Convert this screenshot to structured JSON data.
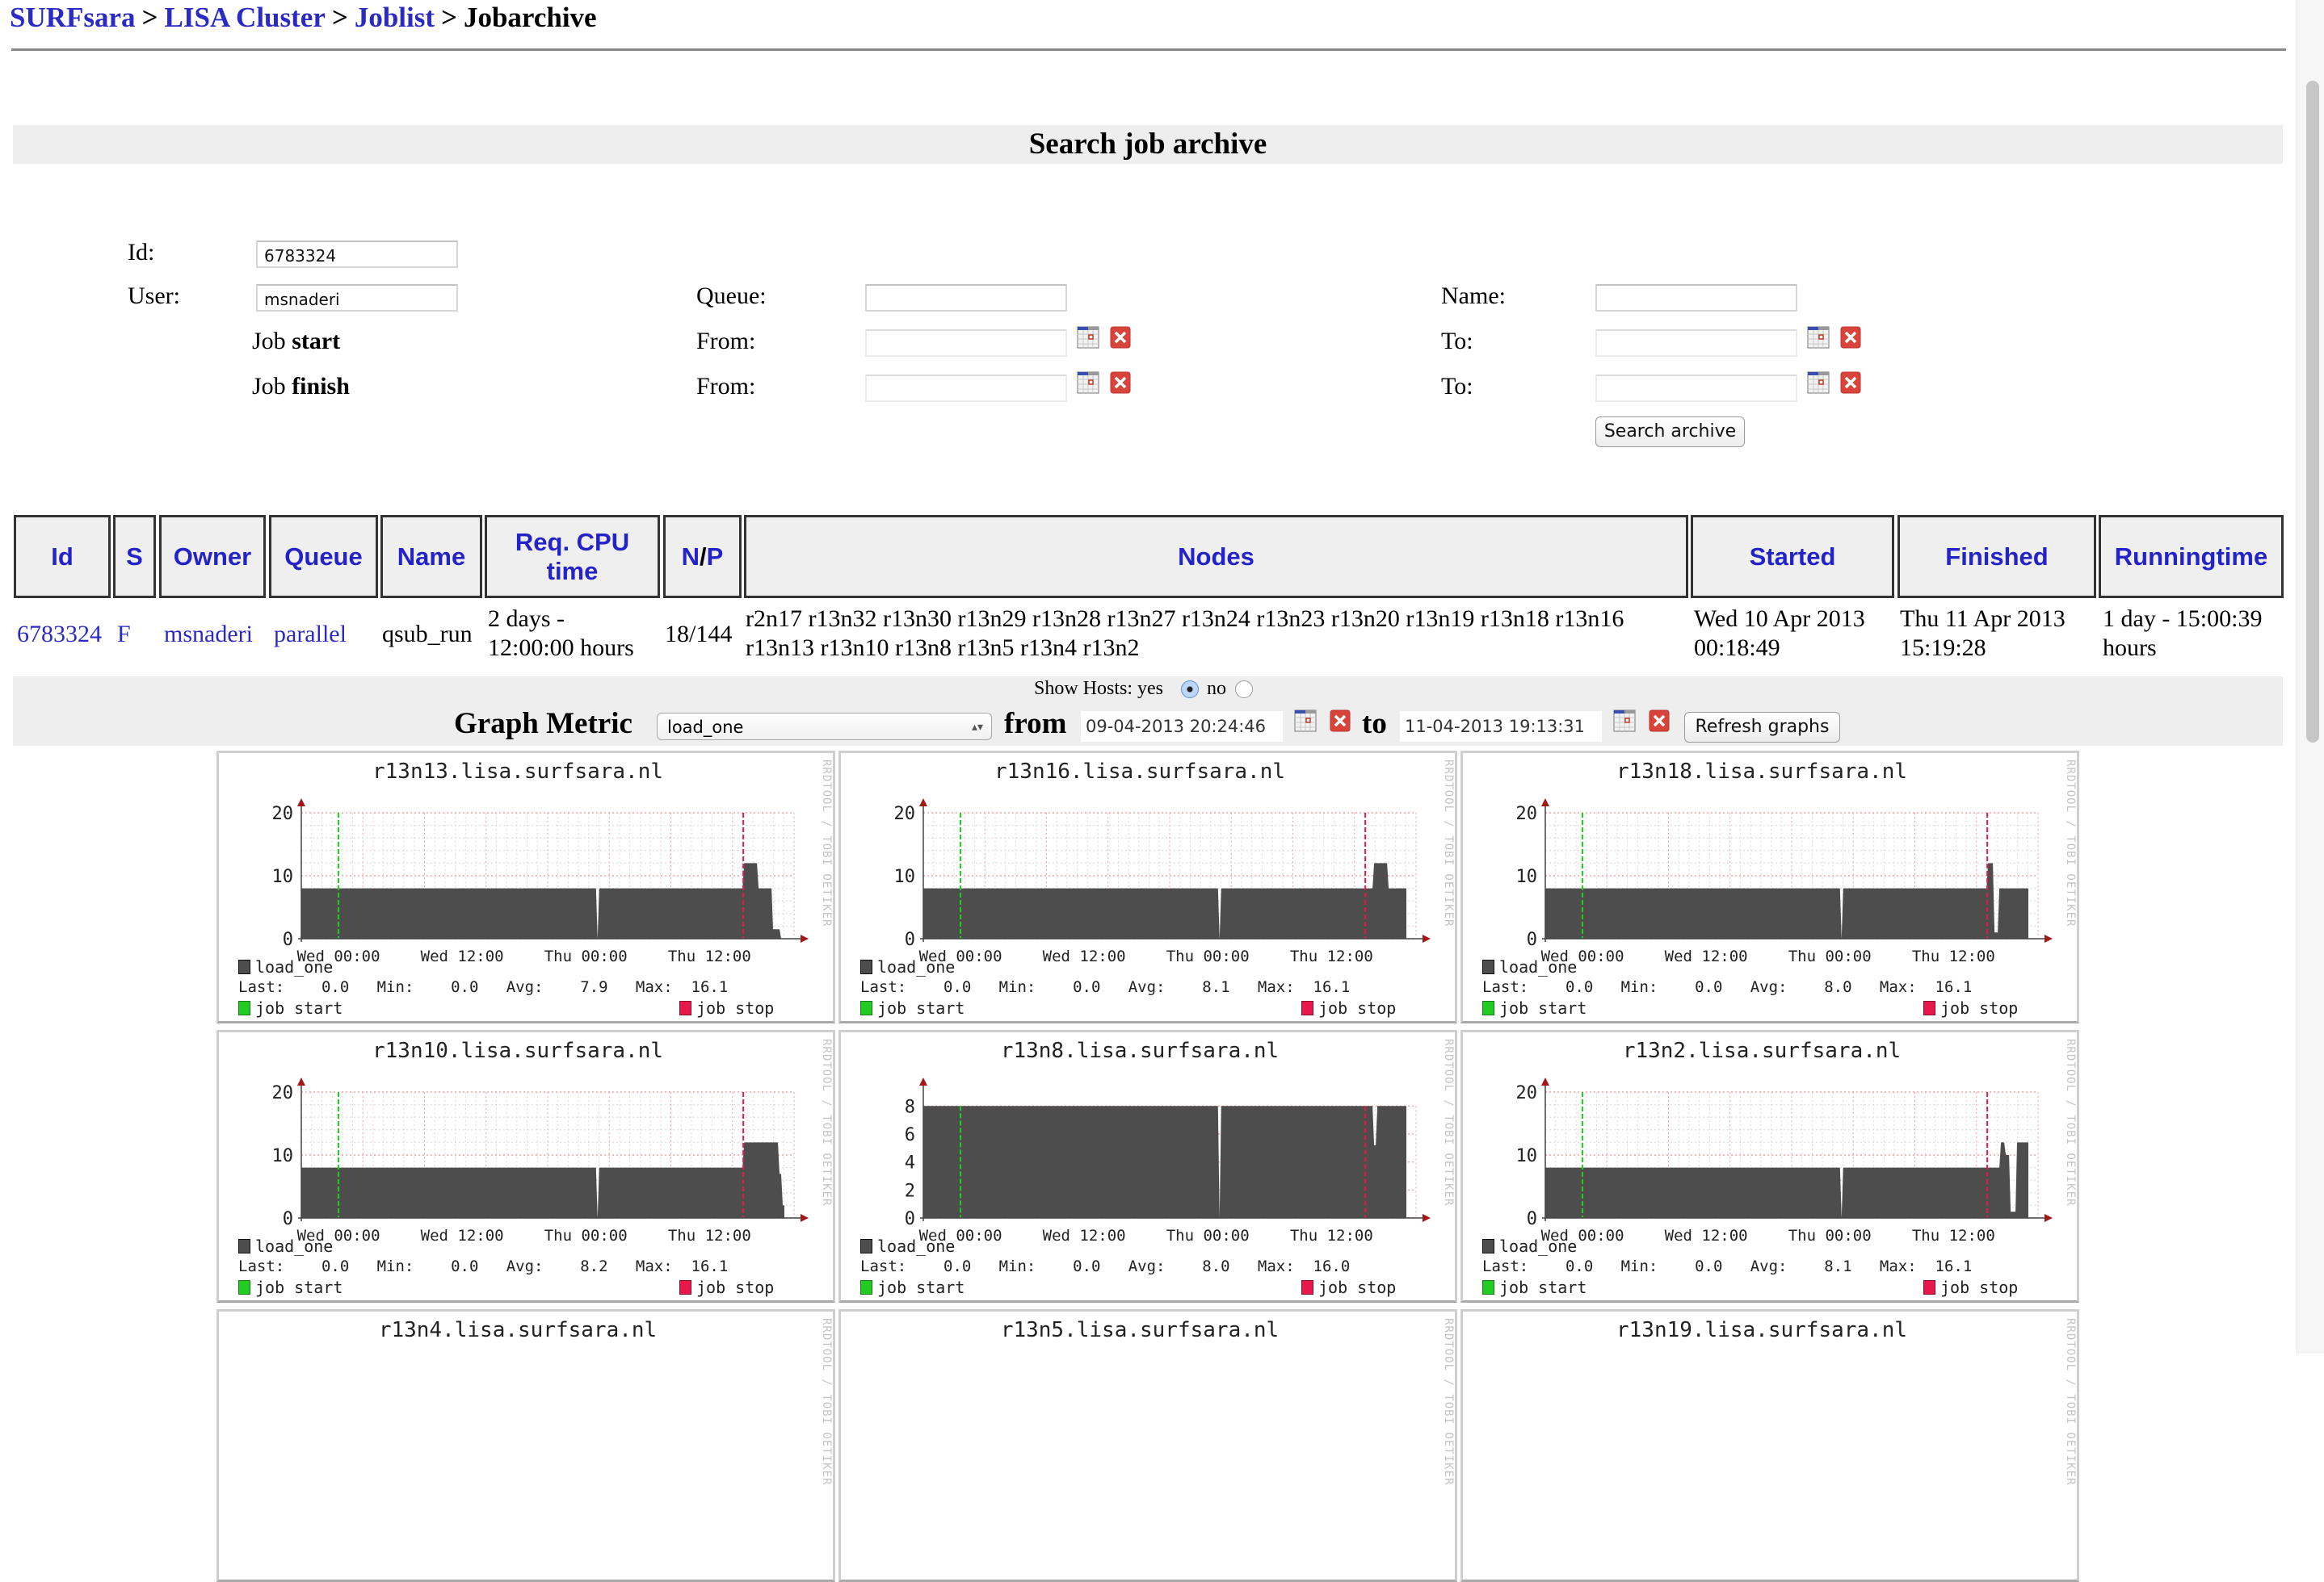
{
  "breadcrumb": {
    "items": [
      "SURFsara",
      "LISA Cluster",
      "Joblist",
      "Jobarchive"
    ],
    "separator": ">"
  },
  "search": {
    "title": "Search job archive",
    "id_label": "Id:",
    "id_value": "6783324",
    "user_label": "User:",
    "user_value": "msnaderi",
    "queue_label": "Queue:",
    "queue_value": "",
    "name_label": "Name:",
    "name_value": "",
    "job_start_prefix": "Job ",
    "job_start_bold": "start",
    "job_finish_prefix": "Job ",
    "job_finish_bold": "finish",
    "from_label": "From:",
    "to_label": "To:",
    "search_button": "Search archive"
  },
  "table": {
    "headers": [
      "Id",
      "S",
      "Owner",
      "Queue",
      "Name",
      "Req. CPU time",
      "N/P",
      "Nodes",
      "Started",
      "Finished",
      "Runningtime"
    ],
    "header_np": {
      "n": "N",
      "slash": "/",
      "p": "P"
    },
    "header_cpu": {
      "line1": "Req. CPU",
      "line2": "time"
    },
    "row": {
      "id": "6783324",
      "state": "F",
      "owner": "msnaderi",
      "queue": "parallel",
      "name": "qsub_run",
      "req_cpu_line1": "2 days -",
      "req_cpu_line2": "12:00:00 hours",
      "np": "18/144",
      "nodes_line1": "r2n17 r13n32 r13n30 r13n29 r13n28 r13n27 r13n24 r13n23 r13n20 r13n19 r13n18 r13n16",
      "nodes_line2": "r13n13 r13n10 r13n8 r13n5 r13n4 r13n2",
      "started_line1": "Wed 10 Apr 2013",
      "started_line2": "00:18:49",
      "finished_line1": "Thu 11 Apr 2013",
      "finished_line2": "15:19:28",
      "runningtime_line1": "1 day - 15:00:39",
      "runningtime_line2": "hours"
    }
  },
  "graph_controls": {
    "show_hosts_label": "Show Hosts: yes",
    "no_label": "no",
    "show_hosts": "yes",
    "metric_label": "Graph Metric",
    "metric_value": "load_one",
    "from_label": "from",
    "from_value": "09-04-2013 20:24:46",
    "to_label": "to",
    "to_value": "11-04-2013 19:13:31",
    "refresh_button": "Refresh graphs"
  },
  "graph_common": {
    "xticks": [
      "Wed 00:00",
      "Wed 12:00",
      "Thu 00:00",
      "Thu 12:00"
    ],
    "legend_series": "load_one",
    "legend_start": "job start",
    "legend_stop": "job stop",
    "watermark": "RRDTOOL / TOBI OETIKER",
    "last_label": "Last:",
    "min_label": "Min:",
    "avg_label": "Avg:",
    "max_label": "Max:",
    "colors": {
      "area": "#4d4d4d",
      "start": "#22cc22",
      "stop": "#e8194a"
    }
  },
  "chart_data": [
    {
      "type": "area",
      "title": "r13n13.lisa.surfsara.nl",
      "ylim": [
        0,
        20
      ],
      "yticks": [
        0,
        10,
        20
      ],
      "last": "0.0",
      "min": "0.0",
      "avg": "7.9",
      "max": "16.1",
      "tail": "drop"
    },
    {
      "type": "area",
      "title": "r13n16.lisa.surfsara.nl",
      "ylim": [
        0,
        20
      ],
      "yticks": [
        0,
        10,
        20
      ],
      "last": "0.0",
      "min": "0.0",
      "avg": "8.1",
      "max": "16.1",
      "tail": "bump"
    },
    {
      "type": "area",
      "title": "r13n18.lisa.surfsara.nl",
      "ylim": [
        0,
        20
      ],
      "yticks": [
        0,
        10,
        20
      ],
      "last": "0.0",
      "min": "0.0",
      "avg": "8.0",
      "max": "16.1",
      "tail": "dip"
    },
    {
      "type": "area",
      "title": "r13n10.lisa.surfsara.nl",
      "ylim": [
        0,
        20
      ],
      "yticks": [
        0,
        10,
        20
      ],
      "last": "0.0",
      "min": "0.0",
      "avg": "8.2",
      "max": "16.1",
      "tail": "high"
    },
    {
      "type": "area",
      "title": "r13n8.lisa.surfsara.nl",
      "ylim": [
        0,
        9
      ],
      "yticks": [
        0,
        2,
        4,
        6,
        8
      ],
      "last": "0.0",
      "min": "0.0",
      "avg": "8.0",
      "max": "16.0",
      "tail": "flat8"
    },
    {
      "type": "area",
      "title": "r13n2.lisa.surfsara.nl",
      "ylim": [
        0,
        20
      ],
      "yticks": [
        0,
        10,
        20
      ],
      "last": "0.0",
      "min": "0.0",
      "avg": "8.1",
      "max": "16.1",
      "tail": "gap"
    },
    {
      "type": "area",
      "title": "r13n4.lisa.surfsara.nl"
    },
    {
      "type": "area",
      "title": "r13n5.lisa.surfsara.nl"
    },
    {
      "type": "area",
      "title": "r13n19.lisa.surfsara.nl"
    }
  ]
}
